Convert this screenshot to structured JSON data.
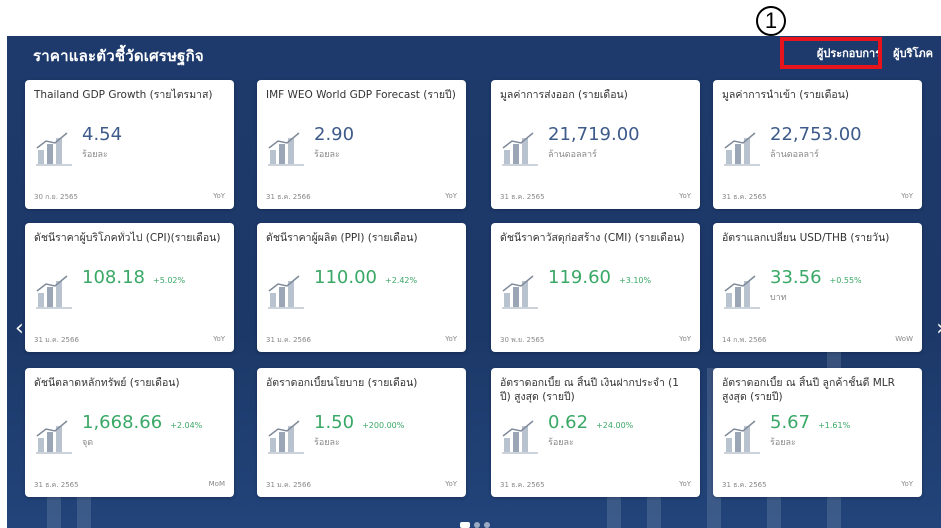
{
  "section": {
    "title": "ราคาและตัวชี้วัดเศรษฐกิจ",
    "tabs": [
      {
        "label": "ผู้ประกอบการ",
        "active": true
      },
      {
        "label": "ผู้บริโภค",
        "active": false
      }
    ]
  },
  "annotation": {
    "step": "1",
    "color": "#e8141b"
  },
  "colors": {
    "background": "#1e3a6c",
    "value_blue": "#3d5a8a",
    "value_green": "#3aa866"
  },
  "cards": [
    {
      "title": "Thailand GDP Growth (รายไตรมาส)",
      "value": "4.54",
      "change": "",
      "unit": "ร้อยละ",
      "date": "30 ก.ย. 2565",
      "period": "YoY",
      "icon": "thailand-map-chart-icon"
    },
    {
      "title": "IMF WEO World GDP Forecast (รายปี)",
      "value": "2.90",
      "change": "",
      "unit": "ร้อยละ",
      "date": "31 ธ.ค. 2566",
      "period": "YoY",
      "icon": "globe-chart-icon"
    },
    {
      "title": "มูลค่าการส่งออก (รายเดือน)",
      "value": "21,719.00",
      "change": "",
      "unit": "ล้านดอลลาร์",
      "date": "31 ธ.ค. 2565",
      "period": "YoY",
      "icon": "export-map-icon"
    },
    {
      "title": "มูลค่าการนำเข้า (รายเดือน)",
      "value": "22,753.00",
      "change": "",
      "unit": "ล้านดอลลาร์",
      "date": "31 ธ.ค. 2565",
      "period": "YoY",
      "icon": "import-map-icon"
    },
    {
      "title": "ดัชนีราคาผู้บริโภคทั่วไป (CPI)(รายเดือน)",
      "value": "108.18",
      "change": "+5.02%",
      "unit": "",
      "date": "31 ม.ค. 2566",
      "period": "YoY",
      "icon": "consumer-chart-icon"
    },
    {
      "title": "ดัชนีราคาผู้ผลิต (PPI) (รายเดือน)",
      "value": "110.00",
      "change": "+2.42%",
      "unit": "",
      "date": "31 ม.ค. 2566",
      "period": "YoY",
      "icon": "producer-chart-icon"
    },
    {
      "title": "ดัชนีราคาวัสดุก่อสร้าง (CMI) (รายเดือน)",
      "value": "119.60",
      "change": "+3.10%",
      "unit": "",
      "date": "30 พ.ย. 2565",
      "period": "YoY",
      "icon": "construction-tools-icon"
    },
    {
      "title": "อัตราแลกเปลี่ยน USD/THB (รายวัน)",
      "value": "33.56",
      "change": "+0.55%",
      "unit": "บาท",
      "date": "14 ก.พ. 2566",
      "period": "WoW",
      "icon": "currency-exchange-icon"
    },
    {
      "title": "ดัชนีตลาดหลักทรัพย์ (รายเดือน)",
      "value": "1,668.66",
      "change": "+2.04%",
      "unit": "จุด",
      "date": "31 ธ.ค. 2565",
      "period": "MoM",
      "icon": "stock-chart-icon"
    },
    {
      "title": "อัตราดอกเบี้ยนโยบาย (รายเดือน)",
      "value": "1.50",
      "change": "+200.00%",
      "unit": "ร้อยละ",
      "date": "31 ม.ค. 2566",
      "period": "YoY",
      "icon": "plant-hand-icon"
    },
    {
      "title": "อัตราดอกเบี้ย ณ สิ้นปี เงินฝากประจำ (1 ปี) สูงสุด (รายปี)",
      "value": "0.62",
      "change": "+24.00%",
      "unit": "ร้อยละ",
      "date": "31 ธ.ค. 2565",
      "period": "YoY",
      "icon": "deposit-plant-icon"
    },
    {
      "title": "อัตราดอกเบี้ย ณ สิ้นปี ลูกค้าชั้นดี MLR สูงสุด (รายปี)",
      "value": "5.67",
      "change": "+1.61%",
      "unit": "ร้อยละ",
      "date": "31 ธ.ค. 2565",
      "period": "YoY",
      "icon": "loan-growth-icon"
    }
  ],
  "pager": {
    "count": 3,
    "active": 0
  }
}
